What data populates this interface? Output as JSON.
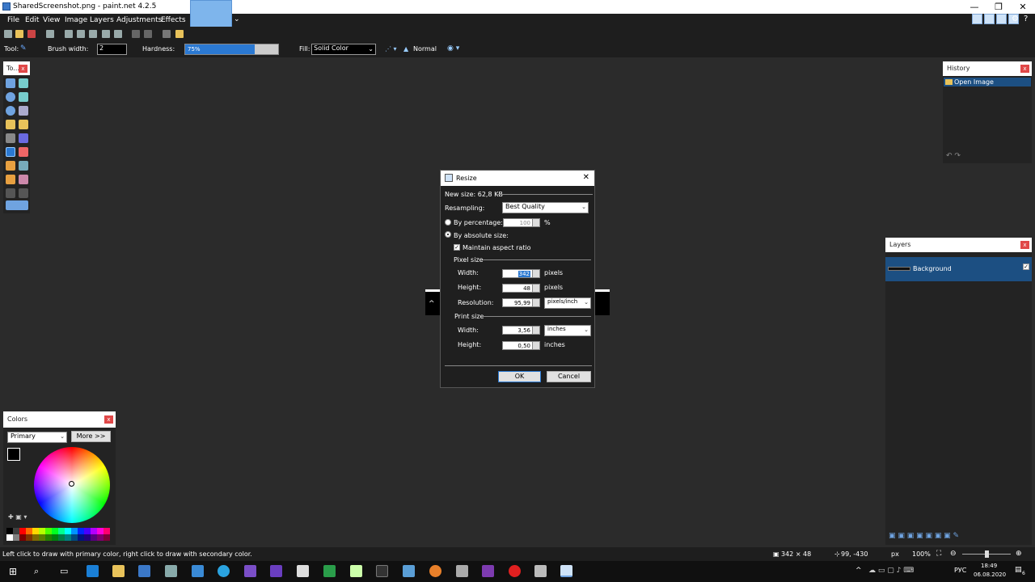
{
  "window": {
    "title": "SharedScreenshot.png - paint.net 4.2.5",
    "minimize": "—",
    "restore": "❐",
    "close": "✕"
  },
  "menu": [
    "File",
    "Edit",
    "View",
    "Image",
    "Layers",
    "Adjustments",
    "Effects"
  ],
  "menu_expand": "⌄",
  "toolbar": {
    "tool_label": "Tool:",
    "brush_width_label": "Brush width:",
    "brush_width_value": "2",
    "hardness_label": "Hardness:",
    "hardness_value": "75%",
    "hardness_fraction": 0.75,
    "fill_label": "Fill:",
    "fill_value": "Solid Color",
    "blend_mode": "Normal"
  },
  "tools_panel": {
    "title": "To...",
    "close": "x"
  },
  "history_panel": {
    "title": "History",
    "close": "x",
    "items": [
      "Open Image"
    ]
  },
  "layers_panel": {
    "title": "Layers",
    "close": "x",
    "layers": [
      {
        "name": "Background",
        "visible": true
      }
    ]
  },
  "colors_panel": {
    "title": "Colors",
    "close": "x",
    "mode": "Primary",
    "more_button": "More >>"
  },
  "resize_dialog": {
    "title": "Resize",
    "close": "✕",
    "new_size": "New size: 62,8 KB",
    "resampling_label": "Resampling:",
    "resampling_value": "Best Quality",
    "by_percentage_label": "By percentage:",
    "percentage_value": "100",
    "percent_unit": "%",
    "by_absolute_label": "By absolute size:",
    "maintain_aspect_label": "Maintain aspect ratio",
    "pixel_size_label": "Pixel size",
    "width_label": "Width:",
    "width_value": "342",
    "pixels_unit": "pixels",
    "height_label": "Height:",
    "height_value": "48",
    "resolution_label": "Resolution:",
    "resolution_value": "95,99",
    "resolution_unit": "pixels/inch",
    "print_size_label": "Print size",
    "print_width_label": "Width:",
    "print_width_value": "3,56",
    "inches_unit": "inches",
    "print_height_label": "Height:",
    "print_height_value": "0,50",
    "ok_label": "OK",
    "cancel_label": "Cancel"
  },
  "statusbar": {
    "hint": "Left click to draw with primary color, right click to draw with secondary color.",
    "image_size": "342 × 48",
    "cursor_pos": "99, -430",
    "unit": "px",
    "zoom": "100%"
  },
  "taskbar": {
    "language": "РУС",
    "time": "18:49",
    "date": "06.08.2020",
    "notifications": "6"
  },
  "colors": {
    "accent": "#2b79d2",
    "selected_layer": "#1c4f82",
    "close_red": "#e04848"
  }
}
